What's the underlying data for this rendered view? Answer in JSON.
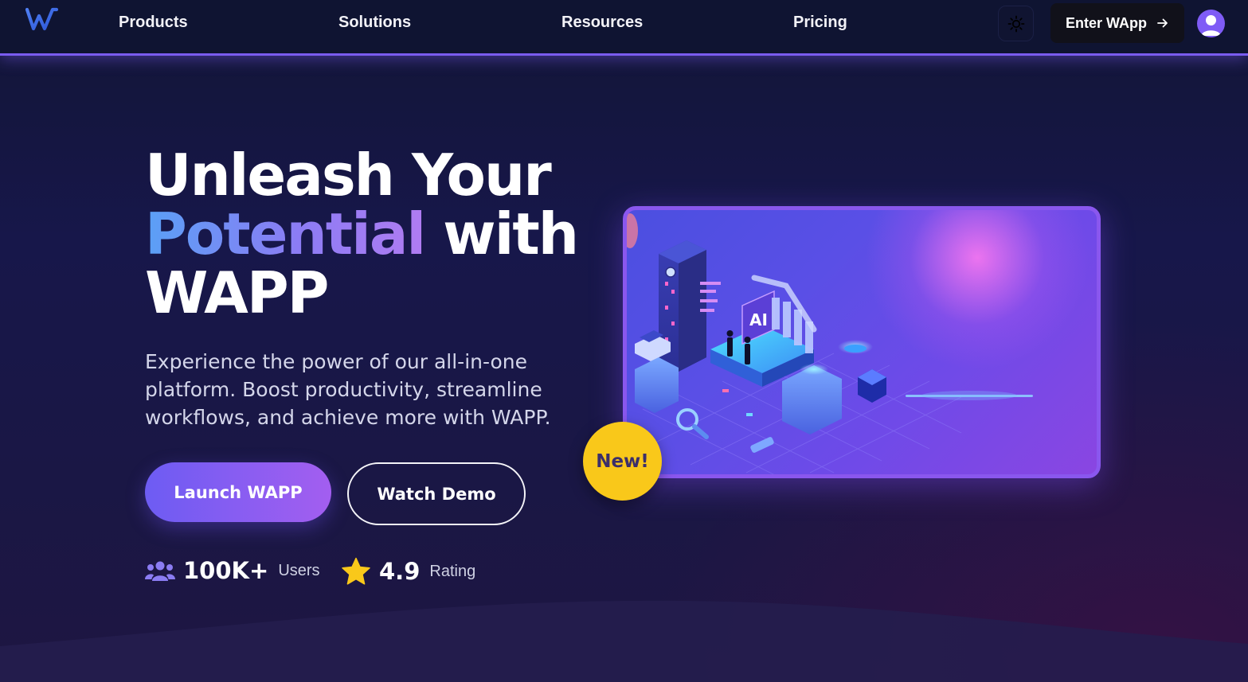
{
  "nav": {
    "logo_letter": "W",
    "links": [
      {
        "label": "Products"
      },
      {
        "label": "Solutions"
      },
      {
        "label": "Resources"
      },
      {
        "label": "Pricing"
      }
    ],
    "theme_icon": "sun-icon",
    "enter_label": "Enter WApp",
    "enter_icon": "arrow-right-icon",
    "avatar_icon": "user-icon"
  },
  "hero": {
    "title_line1": "Unleash Your",
    "title_highlight": "Potential",
    "title_line2_rest": " with",
    "title_line3": "WAPP",
    "subtitle": "Experience the power of our all-in-one platform. Boost productivity, streamline workflows, and achieve more with WAPP.",
    "primary_button": "Launch WAPP",
    "secondary_button": "Watch Demo",
    "stats": [
      {
        "icon": "users-icon",
        "value": "100K+",
        "label": "Users"
      },
      {
        "icon": "star-icon",
        "value": "4.9",
        "label": "Rating"
      }
    ],
    "badge": "New!",
    "illustration_text": "AI"
  },
  "colors": {
    "accent": "#7a5cf0",
    "gradient_start": "#6d5cf3",
    "gradient_end": "#a35ef0",
    "badge": "#f9c81a",
    "star": "#f9c81a"
  }
}
